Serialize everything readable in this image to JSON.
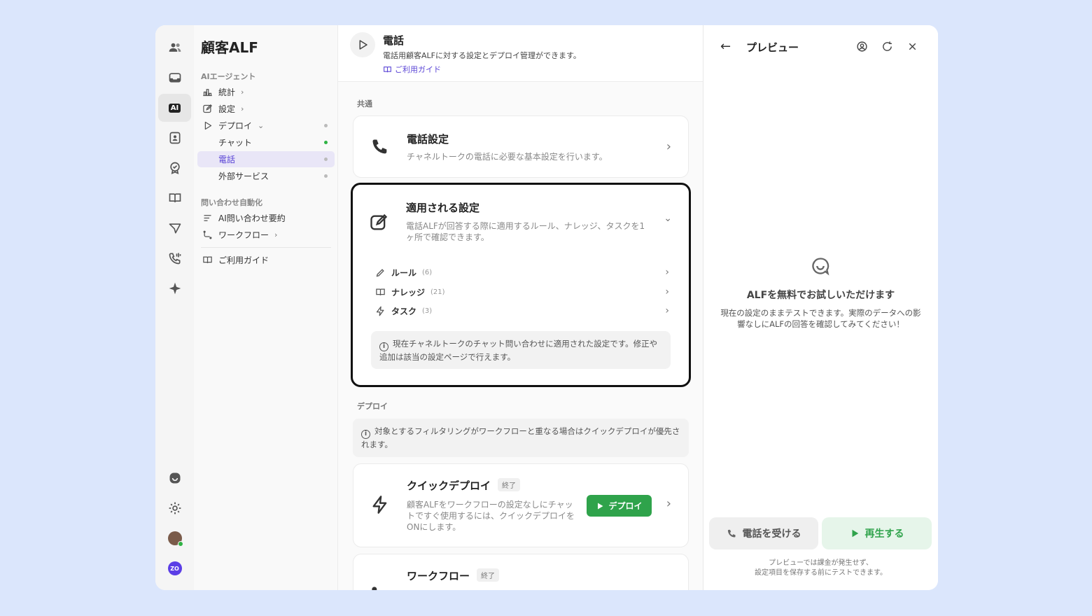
{
  "app": {
    "title": "顧客ALF"
  },
  "sidebar": {
    "section_ai": "AIエージェント",
    "items": [
      {
        "label": "統計",
        "chev": "›"
      },
      {
        "label": "設定",
        "chev": "›"
      },
      {
        "label": "デプロイ",
        "chev": "⌄"
      }
    ],
    "deploy_children": [
      {
        "label": "チャット"
      },
      {
        "label": "電話"
      },
      {
        "label": "外部サービス"
      }
    ],
    "section_auto": "問い合わせ自動化",
    "auto_items": [
      {
        "label": "AI問い合わせ要約"
      },
      {
        "label": "ワークフロー",
        "chev": "›"
      }
    ],
    "guide": "ご利用ガイド"
  },
  "main": {
    "title": "電話",
    "subtitle": "電話用顧客ALFに対する設定とデプロイ管理ができます。",
    "guide_link": "ご利用ガイド",
    "section_common": "共通",
    "phone_card": {
      "title": "電話設定",
      "desc": "チャネルトークの電話に必要な基本設定を行います。"
    },
    "applied_card": {
      "title": "適用される設定",
      "desc": "電話ALFが回答する際に適用するルール、ナレッジ、タスクを1ヶ所で確認できます。",
      "rows": [
        {
          "label": "ルール",
          "count": "(6)"
        },
        {
          "label": "ナレッジ",
          "count": "(21)"
        },
        {
          "label": "タスク",
          "count": "(3)"
        }
      ],
      "note": "現在チャネルトークのチャット問い合わせに適用された設定です。修正や追加は該当の設定ページで行えます。"
    },
    "section_deploy": "デプロイ",
    "deploy_note": "対象とするフィルタリングがワークフローと重なる場合はクイックデプロイが優先されます。",
    "quick_card": {
      "title": "クイックデプロイ",
      "badge": "終了",
      "desc": "顧客ALFをワークフローの設定なしにチャットですぐ使用するには、クイックデプロイをONにします。",
      "button": "デプロイ"
    },
    "workflow_card": {
      "title": "ワークフロー",
      "badge": "終了"
    }
  },
  "preview": {
    "title": "プレビュー",
    "heading": "ALFを無料でお試しいただけます",
    "desc": "現在の設定のままテストできます。実際のデータへの影響なしにALFの回答を確認してみてください！",
    "call_button": "電話を受ける",
    "play_button": "再生する",
    "footer": "プレビューでは課金が発生せず、\n設定項目を保存する前にテストできます。"
  },
  "rail": {
    "ai_badge": "AI",
    "zo": "ZO"
  }
}
